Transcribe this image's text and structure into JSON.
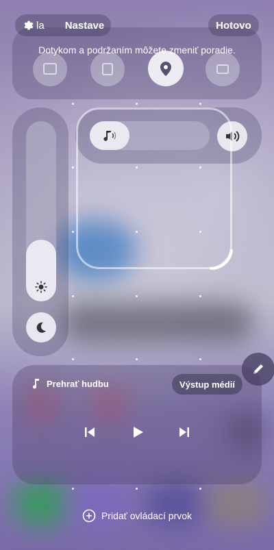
{
  "top_bar": {
    "left_chip_prefix": "la",
    "settings_label": "Nastave",
    "done_label": "Hotovo",
    "hint": "Dotykom a podržaním môžete zmeniť poradie."
  },
  "quick_tiles": [
    {
      "icon": "cast-icon"
    },
    {
      "icon": "note-icon"
    },
    {
      "icon": "location-icon"
    },
    {
      "icon": "cards-icon"
    }
  ],
  "media": {
    "play_label": "Prehrať hudbu",
    "output_label": "Výstup médií"
  },
  "add_control_label": "Pridať ovládací prvok",
  "colors": {
    "accent_white": "#ffffff",
    "panel_dark": "#3c3750"
  }
}
